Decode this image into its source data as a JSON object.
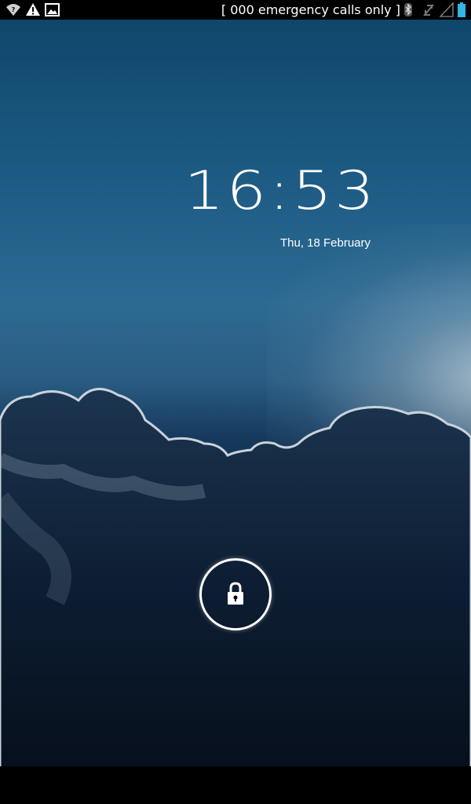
{
  "status_bar": {
    "carrier_text": "[ 000 emergency calls only ]",
    "icons": [
      "wifi-question-icon",
      "warning-icon",
      "picture-icon",
      "bluetooth-icon",
      "no-sim-icon",
      "signal-icon",
      "battery-icon"
    ]
  },
  "lockscreen": {
    "time": "16:53",
    "date": "Thu, 18 February"
  },
  "colors": {
    "text": "#ffffff",
    "battery": "#33b5e5",
    "background_top": "#0f466c",
    "background_bottom": "#070f1c"
  }
}
